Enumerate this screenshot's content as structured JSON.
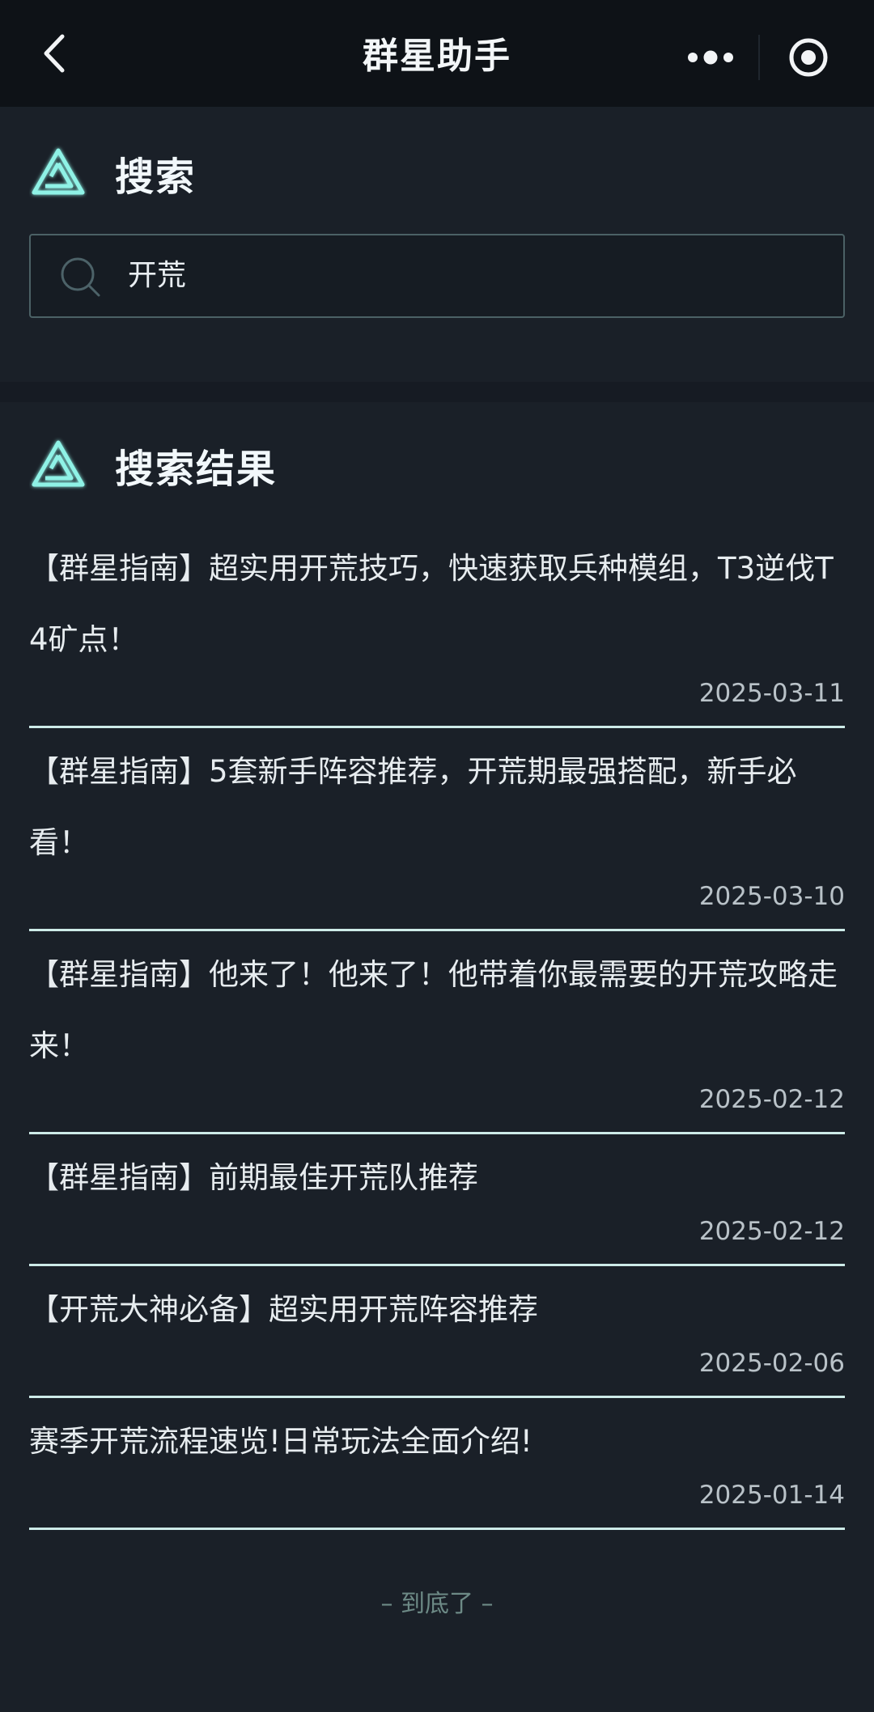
{
  "app": {
    "title": "群星助手"
  },
  "search_section": {
    "title": "搜索",
    "query": "开荒"
  },
  "results_section": {
    "title": "搜索结果",
    "items": [
      {
        "title": "【群星指南】超实用开荒技巧，快速获取兵种模组，T3逆伐T4矿点！",
        "date": "2025-03-11"
      },
      {
        "title": "【群星指南】5套新手阵容推荐，开荒期最强搭配，新手必看！",
        "date": "2025-03-10"
      },
      {
        "title": "【群星指南】他来了！他来了！他带着你最需要的开荒攻略走来！",
        "date": "2025-02-12"
      },
      {
        "title": "【群星指南】前期最佳开荒队推荐",
        "date": "2025-02-12"
      },
      {
        "title": "【开荒大神必备】超实用开荒阵容推荐",
        "date": "2025-02-06"
      },
      {
        "title": "赛季开荒流程速览!日常玩法全面介绍!",
        "date": "2025-01-14"
      }
    ],
    "end_text": "– 到底了 –"
  },
  "icons": {
    "back": "chevron-left-icon",
    "more": "more-dots-icon",
    "close": "target-icon",
    "search": "search-icon",
    "logo": "triangle-logo-icon"
  },
  "colors": {
    "background": "#161b23",
    "navbar": "#0e1217",
    "accent": "#6fe3d8",
    "divider": "#cdebe8"
  }
}
